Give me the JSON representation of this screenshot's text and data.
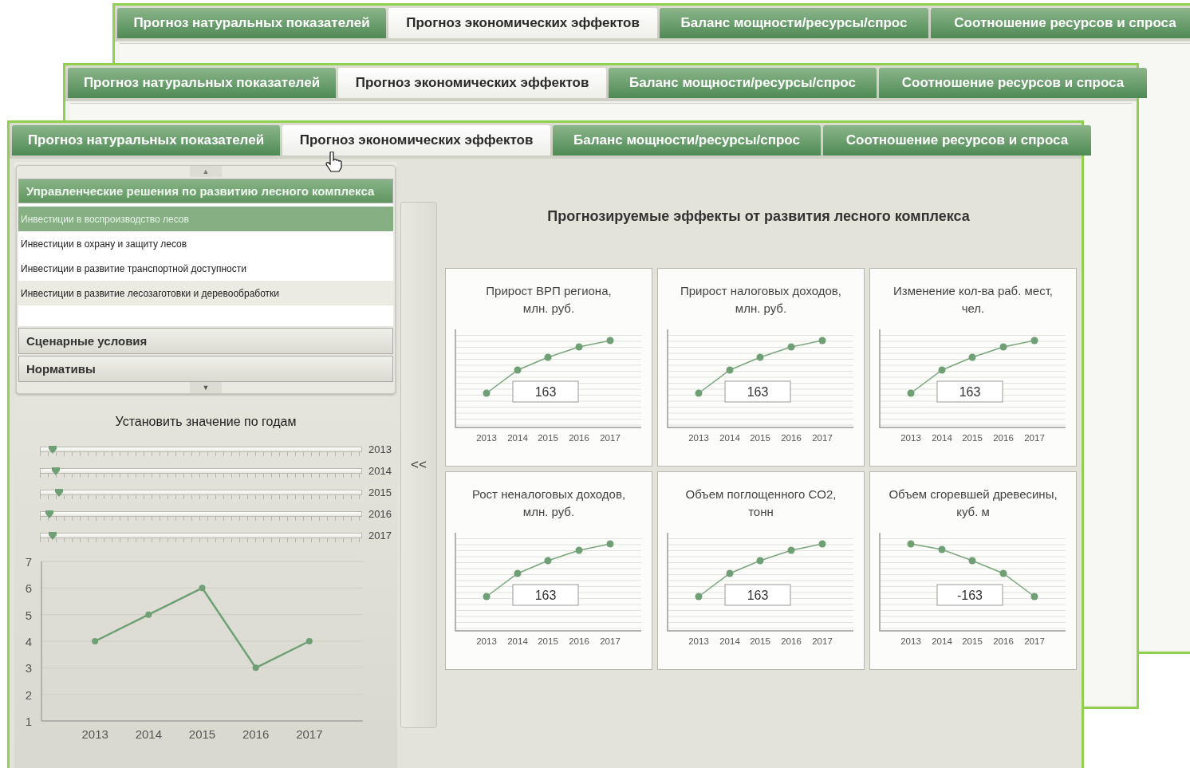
{
  "background_windows": [
    {
      "tabs": [
        {
          "label": "Прогноз натуральных показателей",
          "selected": false
        },
        {
          "label": "Прогноз экономических эффектов",
          "selected": true
        },
        {
          "label": "Баланс мощности/ресурсы/спрос",
          "selected": false
        },
        {
          "label": "Соотношение ресурсов и спроса",
          "selected": false
        }
      ]
    },
    {
      "tabs": [
        {
          "label": "Прогноз натуральных показателей",
          "selected": false
        },
        {
          "label": "Прогноз экономических эффектов",
          "selected": true
        },
        {
          "label": "Баланс мощности/ресурсы/спрос",
          "selected": false
        },
        {
          "label": "Соотношение ресурсов и спроса",
          "selected": false
        }
      ]
    }
  ],
  "window": {
    "tabs": [
      {
        "label": "Прогноз натуральных показателей",
        "selected": false
      },
      {
        "label": "Прогноз экономических эффектов",
        "selected": true
      },
      {
        "label": "Баланс мощности/ресурсы/спрос",
        "selected": false
      },
      {
        "label": "Соотношение ресурсов и спроса",
        "selected": false
      }
    ],
    "sidebar": {
      "scroll_up": "▲",
      "scroll_down": "▼",
      "sections": [
        {
          "title": "Управленческие решения по развитию лесного комплекса",
          "expanded": true,
          "items": [
            {
              "label": "Инвестиции в воспроизводство лесов",
              "selected": true,
              "highlighted": false
            },
            {
              "label": "Инвестиции в охрану и защиту лесов",
              "selected": false,
              "highlighted": false
            },
            {
              "label": "Инвестиции в развитие транспортной доступности",
              "selected": false,
              "highlighted": false
            },
            {
              "label": "Инвестиции в развитие лесозаготовки и деревообработки",
              "selected": false,
              "highlighted": true
            }
          ]
        },
        {
          "title": "Сценарные условия",
          "expanded": false
        },
        {
          "title": "Нормативы",
          "expanded": false
        }
      ],
      "slider_title": "Установить значение по годам",
      "sliders": [
        {
          "label": "2013",
          "level": 0.04
        },
        {
          "label": "2014",
          "level": 0.05
        },
        {
          "label": "2015",
          "level": 0.06
        },
        {
          "label": "2016",
          "level": 0.03
        },
        {
          "label": "2017",
          "level": 0.04
        }
      ],
      "chart_data": {
        "type": "line",
        "categories": [
          "2013",
          "2014",
          "2015",
          "2016",
          "2017"
        ],
        "series": [
          {
            "color": "#6f9f74",
            "marker": true,
            "values": [
              4,
              5,
              6,
              3,
              4
            ]
          }
        ],
        "grid": true,
        "ylim": [
          1,
          7
        ],
        "yticks": [
          1,
          2,
          3,
          4,
          5,
          6,
          7
        ]
      }
    },
    "collapse_button": "<<",
    "main": {
      "title": "Прогнозируемые эффекты от развития лесного комплекса",
      "cards": [
        {
          "title_lines": [
            "Прирост ВРП региона,",
            "млн. руб."
          ],
          "value": "163",
          "kind": "rising",
          "x_labels": [
            "2013",
            "2014",
            "2015",
            "2016",
            "2017"
          ]
        },
        {
          "title_lines": [
            "Прирост налоговых доходов,",
            "млн. руб."
          ],
          "value": "163",
          "kind": "rising",
          "x_labels": [
            "2013",
            "2014",
            "2015",
            "2016",
            "2017"
          ]
        },
        {
          "title_lines": [
            "Изменение кол-ва раб. мест,",
            "чел."
          ],
          "value": "163",
          "kind": "rising",
          "x_labels": [
            "2013",
            "2014",
            "2015",
            "2016",
            "2017"
          ]
        },
        {
          "title_lines": [
            "Рост неналоговых доходов,",
            "млн. руб."
          ],
          "value": "163",
          "kind": "rising",
          "x_labels": [
            "2013",
            "2014",
            "2015",
            "2016",
            "2017"
          ]
        },
        {
          "title_lines": [
            "Объем поглощенного CO2,",
            "тонн"
          ],
          "value": "163",
          "kind": "rising",
          "x_labels": [
            "2013",
            "2014",
            "2015",
            "2016",
            "2017"
          ]
        },
        {
          "title_lines": [
            "Объем сгоревшей древесины,",
            "куб. м"
          ],
          "value": "-163",
          "kind": "falling",
          "x_labels": [
            "2013",
            "2014",
            "2015",
            "2016",
            "2017"
          ]
        }
      ]
    }
  }
}
